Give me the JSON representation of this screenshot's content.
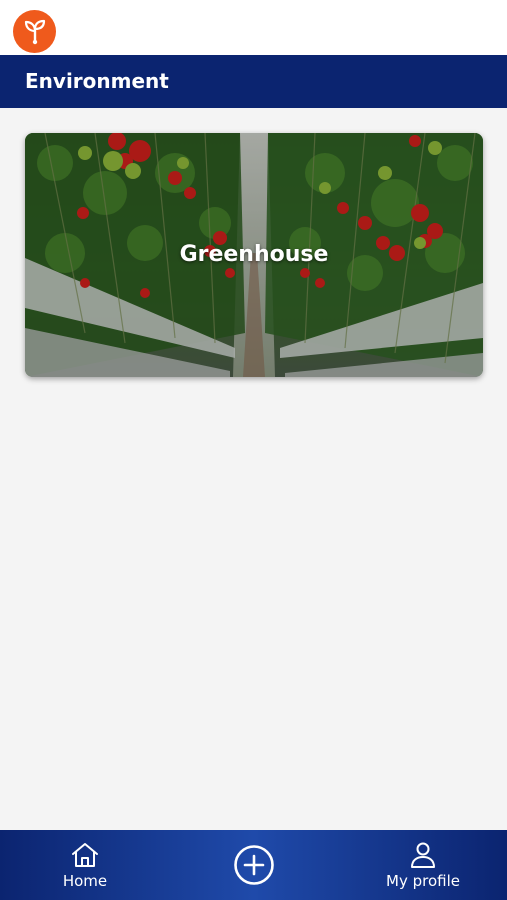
{
  "app": {
    "logo_icon": "sprout-icon",
    "brand_color": "#ef5a1c"
  },
  "header": {
    "title": "Environment",
    "background": "#0b2470"
  },
  "environments": [
    {
      "label": "Greenhouse",
      "image": "greenhouse-tomato-rows"
    }
  ],
  "bottom_nav": {
    "items": [
      {
        "label": "Home",
        "icon": "home-icon"
      },
      {
        "label": "",
        "icon": "add-circle-icon"
      },
      {
        "label": "My profile",
        "icon": "user-icon"
      }
    ]
  }
}
